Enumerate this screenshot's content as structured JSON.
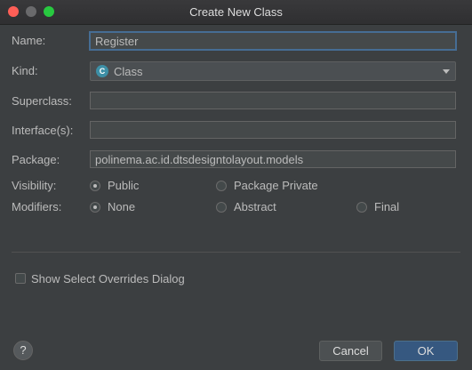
{
  "window": {
    "title": "Create New Class"
  },
  "form": {
    "name_label": "Name:",
    "name_value": "Register",
    "kind_label": "Kind:",
    "kind_value": "Class",
    "kind_icon_glyph": "C",
    "superclass_label": "Superclass:",
    "superclass_value": "",
    "interfaces_label": "Interface(s):",
    "interfaces_value": "",
    "package_label": "Package:",
    "package_value": "polinema.ac.id.dtsdesigntolayout.models",
    "visibility_label": "Visibility:",
    "visibility_options": [
      {
        "label": "Public",
        "checked": true
      },
      {
        "label": "Package Private",
        "checked": false
      }
    ],
    "modifiers_label": "Modifiers:",
    "modifiers_options": [
      {
        "label": "None",
        "checked": true
      },
      {
        "label": "Abstract",
        "checked": false
      },
      {
        "label": "Final",
        "checked": false
      }
    ],
    "overrides_checkbox_label": "Show Select Overrides Dialog",
    "overrides_checked": false
  },
  "footer": {
    "help_label": "?",
    "cancel_label": "Cancel",
    "ok_label": "OK"
  },
  "colors": {
    "background": "#3c3f41",
    "accent_focus": "#466d94",
    "ok_button": "#365880",
    "close": "#ff5f57",
    "maximize": "#28c940",
    "class_icon": "#3d8fa6"
  },
  "icons": {
    "kind": "class-icon",
    "kind_dropdown": "chevron-down-icon",
    "help": "help-icon"
  }
}
